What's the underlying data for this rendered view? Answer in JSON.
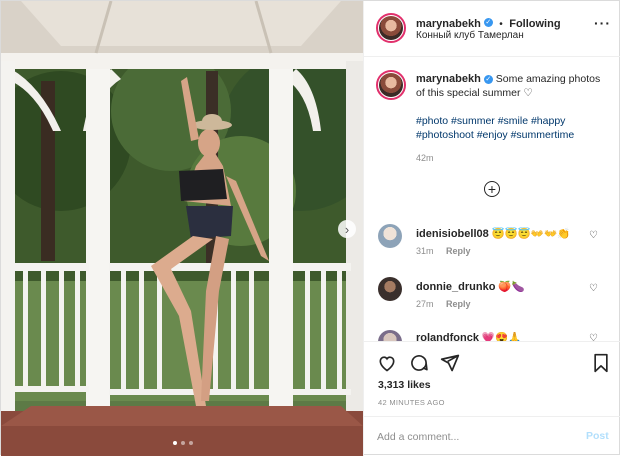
{
  "post_header": {
    "username": "marynabekh",
    "dot": "•",
    "follow_label": "Following",
    "location": "Конный клуб Тамерлан",
    "more_icon": "ellipsis-icon"
  },
  "caption": {
    "username": "marynabekh",
    "text": "Some amazing photos of this special summer ♡",
    "hashtags": "#photo #summer #smile #happy #photoshoot #enjoy #summertime",
    "time": "42m"
  },
  "load_more_icon": "plus-circle-icon",
  "comments": [
    {
      "username": "idenisiobell08",
      "text": "😇😇😇👐👐👏",
      "time": "31m",
      "reply": "Reply"
    },
    {
      "username": "donnie_drunko",
      "text": "🍑🍆",
      "time": "27m",
      "reply": "Reply"
    },
    {
      "username": "rolandfonck",
      "text": "💗😍🙏",
      "time": "",
      "reply": ""
    }
  ],
  "actions": {
    "like_icon": "heart-icon",
    "comment_icon": "comment-icon",
    "share_icon": "share-icon",
    "save_icon": "bookmark-icon"
  },
  "likes": "3,313 likes",
  "posted_ago": "42 MINUTES AGO",
  "add_comment": {
    "placeholder": "Add a comment...",
    "post_label": "Post"
  },
  "carousel": {
    "current": 1,
    "total": 3
  },
  "colors": {
    "link": "#00376b",
    "verified": "#3897f0",
    "post_disabled": "#b2dffc"
  }
}
